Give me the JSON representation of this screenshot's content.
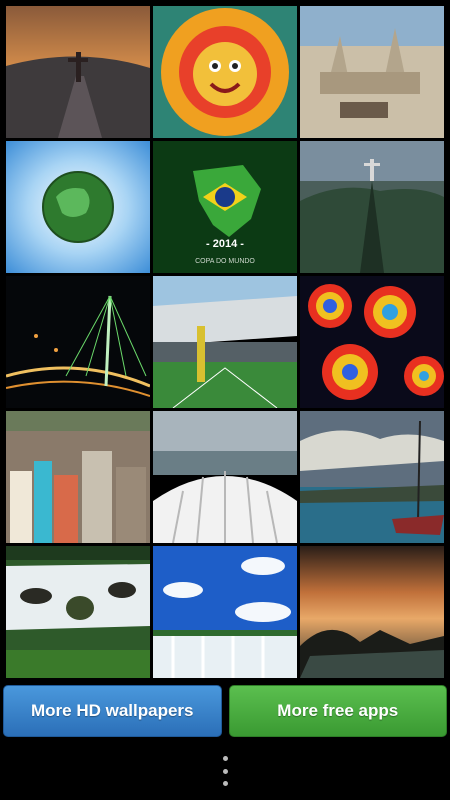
{
  "wallpapers": [
    {
      "name": "Christ the Redeemer at sunset"
    },
    {
      "name": "Colorful sun mask"
    },
    {
      "name": "Sand castle on beach"
    },
    {
      "name": "Green globe"
    },
    {
      "name": "Brazil map flag",
      "caption": "- 2014 -",
      "subcaption": "COPA DO MUNDO"
    },
    {
      "name": "Rio aerial view"
    },
    {
      "name": "Bridge at night"
    },
    {
      "name": "Stadium"
    },
    {
      "name": "Fractal pattern"
    },
    {
      "name": "Favela houses"
    },
    {
      "name": "White arena roof"
    },
    {
      "name": "Harbor with boats"
    },
    {
      "name": "Waterfall rocks"
    },
    {
      "name": "Iguazu falls"
    },
    {
      "name": "Sunset over bay"
    }
  ],
  "buttons": {
    "more_wallpapers": "More HD wallpapers",
    "more_apps": "More free apps"
  },
  "colors": {
    "blue_button": "#2b6fb8",
    "green_button": "#3a9a32"
  },
  "icons": {
    "menu": "overflow-menu-icon"
  }
}
